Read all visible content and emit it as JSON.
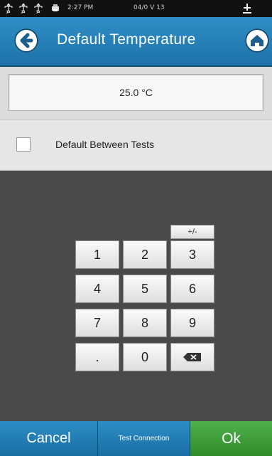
{
  "status_bar": {
    "usb_ports": [
      "1",
      "2",
      "3"
    ],
    "time": "2:27 PM",
    "date": "04/0 V 13",
    "icons": {
      "usb": "usb-icon",
      "printer": "printer-icon",
      "service": "service-icon"
    }
  },
  "header": {
    "title": "Default Temperature",
    "icons": {
      "back": "back-arrow-icon",
      "home": "home-icon"
    }
  },
  "value_field": {
    "value": "25.0 °C"
  },
  "option": {
    "label": "Default Between Tests",
    "checked": false
  },
  "keypad": {
    "sign_key": "+/-",
    "rows": [
      [
        "1",
        "2",
        "3"
      ],
      [
        "4",
        "5",
        "6"
      ],
      [
        "7",
        "8",
        "9"
      ],
      [
        ".",
        "0",
        "backspace"
      ]
    ],
    "backspace_icon": "backspace-icon"
  },
  "footer": {
    "cancel_label": "Cancel",
    "test_label": "Test Connection",
    "ok_label": "Ok"
  },
  "colors": {
    "header_blue": "#2a86bd",
    "ok_green": "#3f9e3a",
    "keypad_background": "#4a4a4a"
  }
}
